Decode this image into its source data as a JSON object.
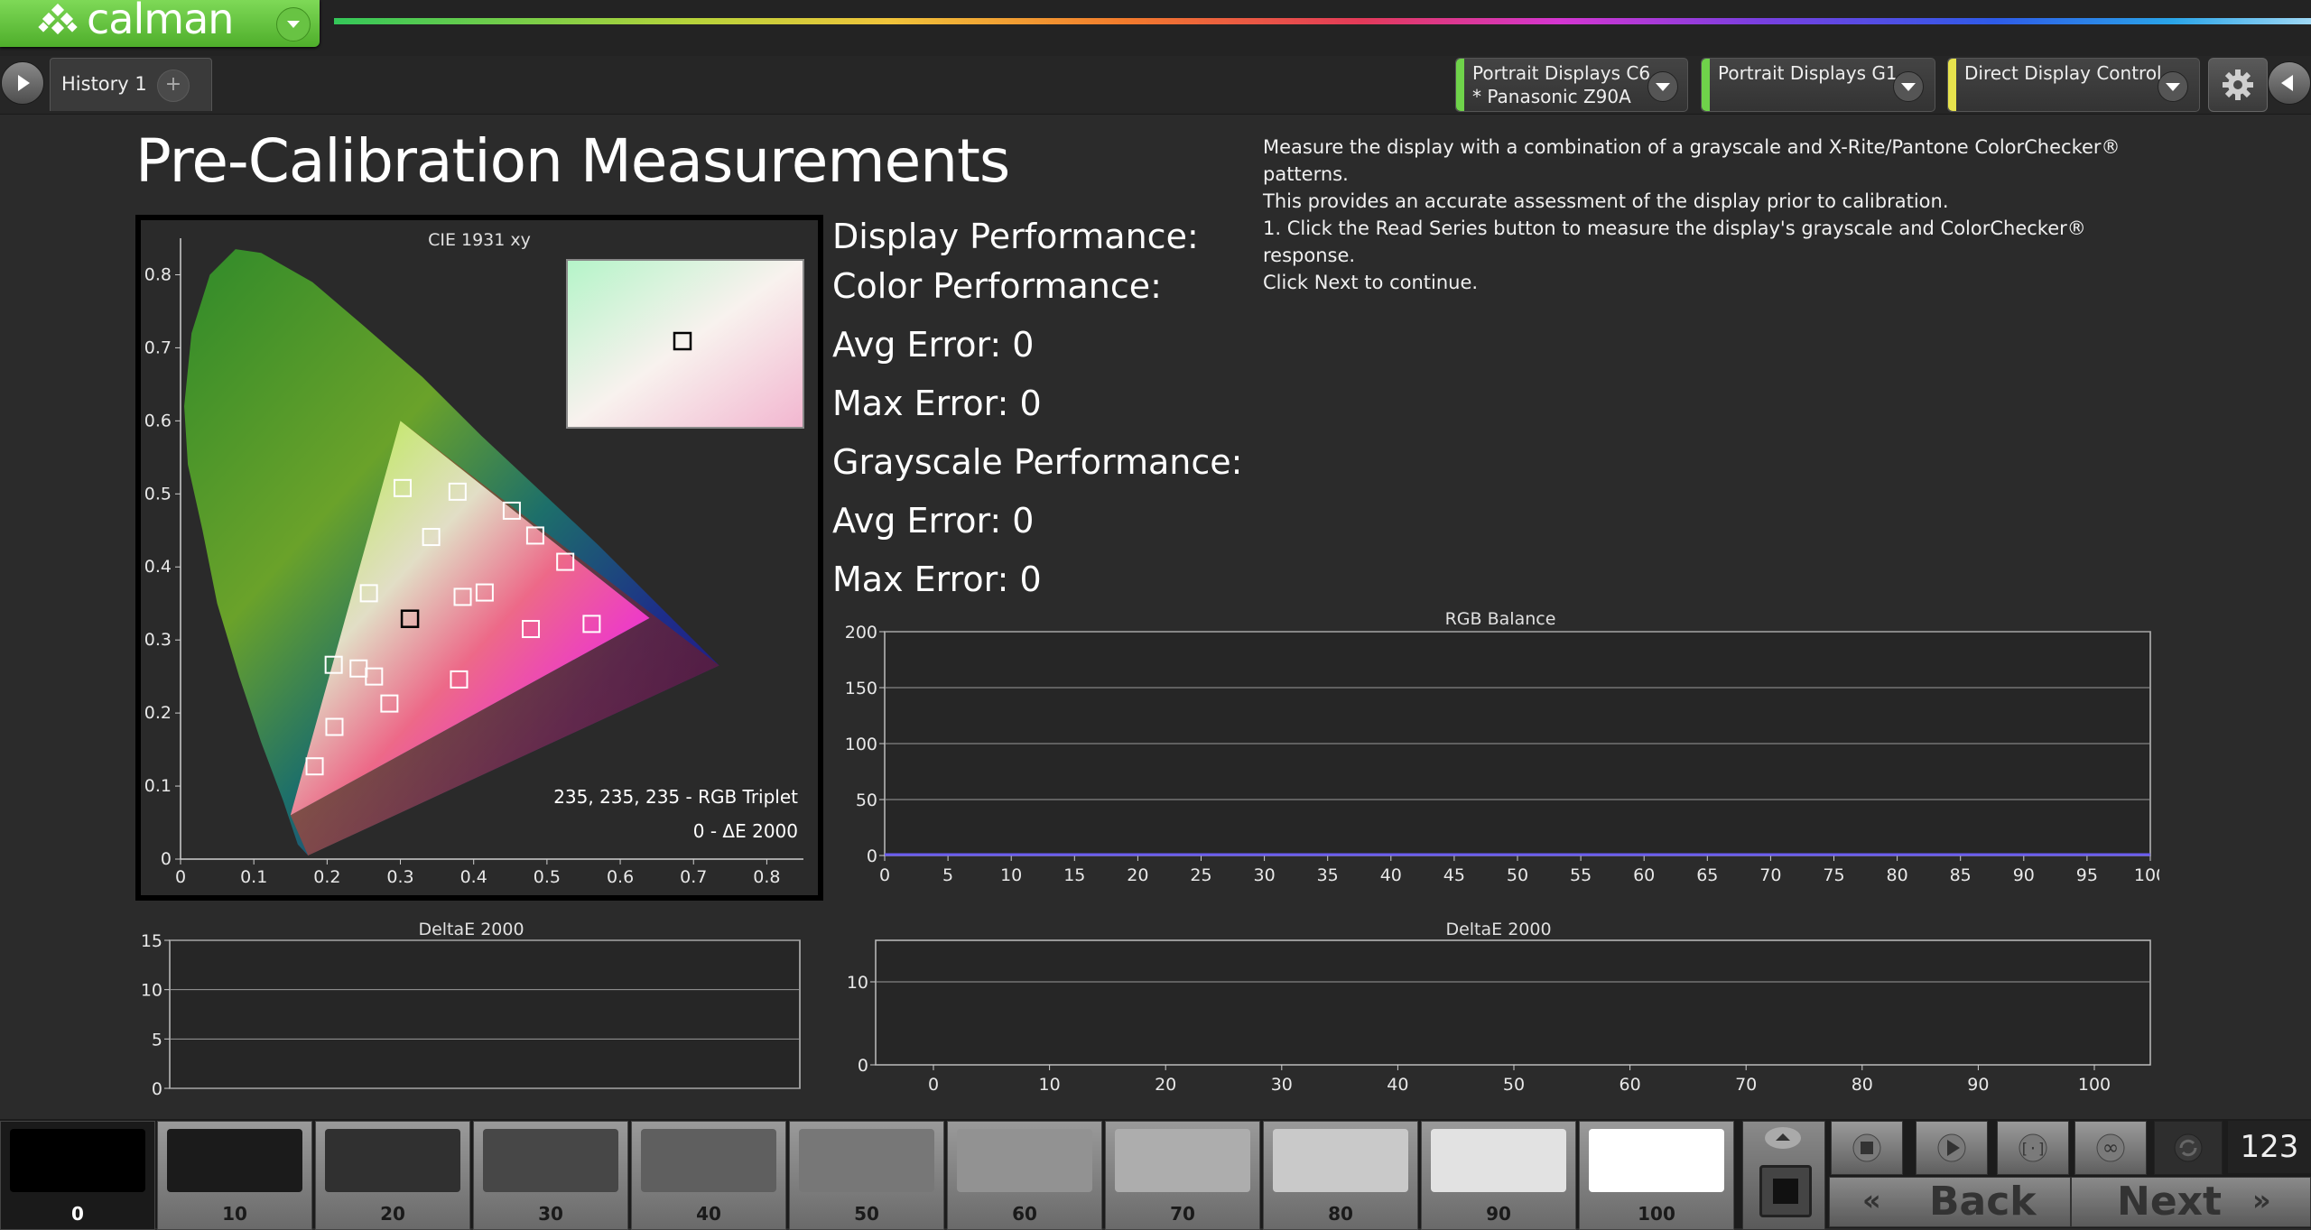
{
  "app": {
    "logo_text": "calman",
    "history_tab": "History 1",
    "history_add": "+",
    "devices": [
      {
        "line1": "Portrait Displays C6",
        "line2": "* Panasonic Z90A",
        "color": "#6fd34a"
      },
      {
        "line1": "Portrait Displays G1",
        "line2": "",
        "color": "#6fd34a"
      },
      {
        "line1": "Direct Display Control",
        "line2": "",
        "color": "#e7e34d"
      }
    ]
  },
  "page": {
    "title": "Pre-Calibration Measurements",
    "description": [
      "Measure the display with a combination of a grayscale and X-Rite/Pantone ColorChecker® patterns.",
      "This provides an accurate assessment of the display prior to calibration.",
      "1. Click the Read Series button to measure the display's grayscale and ColorChecker® response.",
      "Click Next to continue."
    ]
  },
  "performance": {
    "display": "Display Performance:",
    "color": "Color Performance:",
    "color_avg": "Avg Error: 0",
    "color_max": "Max Error: 0",
    "grayscale": "Grayscale Performance:",
    "gray_avg": "Avg Error: 0",
    "gray_max": "Max Error: 0"
  },
  "chart_data": [
    {
      "type": "scatter",
      "title": "CIE 1931 xy",
      "xlim": [
        0,
        0.85
      ],
      "ylim": [
        0,
        0.85
      ],
      "x_ticks": [
        "0",
        "0.1",
        "0.2",
        "0.3",
        "0.4",
        "0.5",
        "0.6",
        "0.7",
        "0.8"
      ],
      "y_ticks": [
        "0",
        "0.1",
        "0.2",
        "0.3",
        "0.4",
        "0.5",
        "0.6",
        "0.7",
        "0.8"
      ],
      "gamut_triangle": [
        [
          0.64,
          0.33
        ],
        [
          0.3,
          0.6
        ],
        [
          0.15,
          0.06
        ]
      ],
      "points": [
        {
          "x": 0.303,
          "y": 0.508
        },
        {
          "x": 0.378,
          "y": 0.503
        },
        {
          "x": 0.452,
          "y": 0.477
        },
        {
          "x": 0.342,
          "y": 0.441
        },
        {
          "x": 0.484,
          "y": 0.443
        },
        {
          "x": 0.525,
          "y": 0.407
        },
        {
          "x": 0.257,
          "y": 0.364
        },
        {
          "x": 0.385,
          "y": 0.359
        },
        {
          "x": 0.415,
          "y": 0.365
        },
        {
          "x": 0.478,
          "y": 0.315
        },
        {
          "x": 0.561,
          "y": 0.322
        },
        {
          "x": 0.209,
          "y": 0.266
        },
        {
          "x": 0.243,
          "y": 0.261
        },
        {
          "x": 0.264,
          "y": 0.25
        },
        {
          "x": 0.38,
          "y": 0.246
        },
        {
          "x": 0.285,
          "y": 0.213
        },
        {
          "x": 0.21,
          "y": 0.181
        },
        {
          "x": 0.183,
          "y": 0.127
        }
      ],
      "target_point": {
        "x": 0.313,
        "y": 0.329
      },
      "annotation_triplet": "235, 235, 235 - RGB Triplet",
      "annotation_de": "0 - ΔE 2000"
    },
    {
      "type": "line",
      "title": "RGB Balance",
      "xlim": [
        0,
        100
      ],
      "ylim": [
        0,
        200
      ],
      "x_ticks": [
        "0",
        "5",
        "10",
        "15",
        "20",
        "25",
        "30",
        "35",
        "40",
        "45",
        "50",
        "55",
        "60",
        "65",
        "70",
        "75",
        "80",
        "85",
        "90",
        "95",
        "100"
      ],
      "y_ticks": [
        "0",
        "50",
        "100",
        "150",
        "200"
      ],
      "series": [
        {
          "values": [
            0,
            0
          ]
        }
      ]
    },
    {
      "type": "bar",
      "title": "DeltaE 2000",
      "ylim": [
        0,
        15
      ],
      "y_ticks": [
        "0",
        "5",
        "10",
        "15"
      ]
    },
    {
      "type": "bar",
      "title": "DeltaE 2000",
      "xlim": [
        0,
        100
      ],
      "ylim": [
        0,
        15
      ],
      "x_ticks": [
        "0",
        "10",
        "20",
        "30",
        "40",
        "50",
        "60",
        "70",
        "80",
        "90",
        "100"
      ],
      "y_ticks": [
        "0",
        "10"
      ]
    }
  ],
  "swatches": [
    {
      "label": "0",
      "color": "#000000"
    },
    {
      "label": "10",
      "color": "#1b1b1b"
    },
    {
      "label": "20",
      "color": "#303030"
    },
    {
      "label": "30",
      "color": "#474747"
    },
    {
      "label": "40",
      "color": "#5f5f5f"
    },
    {
      "label": "50",
      "color": "#777777"
    },
    {
      "label": "60",
      "color": "#929292"
    },
    {
      "label": "70",
      "color": "#adadad"
    },
    {
      "label": "80",
      "color": "#c9c9c9"
    },
    {
      "label": "90",
      "color": "#e2e2e2"
    },
    {
      "label": "100",
      "color": "#ffffff"
    }
  ],
  "controls": {
    "back": "Back",
    "next": "Next",
    "counter": "123"
  }
}
